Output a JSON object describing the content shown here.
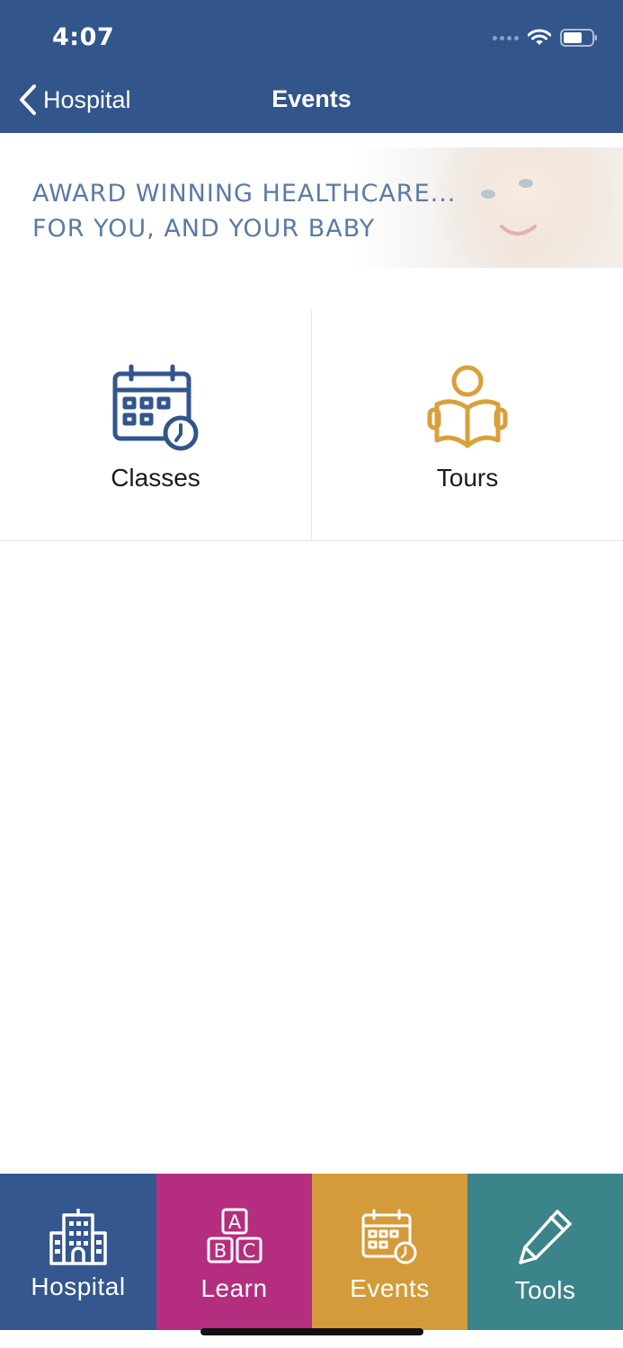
{
  "status_bar": {
    "time": "4:07",
    "icons": [
      "cellular-signal-icon",
      "wifi-icon",
      "battery-icon"
    ]
  },
  "nav": {
    "back_label": "Hospital",
    "title": "Events",
    "background": "#32558c"
  },
  "banner": {
    "line1": "AWARD WINNING HEALTHCARE...",
    "line2": "FOR YOU, AND YOUR BABY",
    "text_color": "#5a7aa6"
  },
  "tiles": [
    {
      "label": "Classes",
      "icon": "calendar-clock-icon",
      "color": "#32558c"
    },
    {
      "label": "Tours",
      "icon": "person-reading-book-icon",
      "color": "#d9a03a"
    }
  ],
  "tabs": [
    {
      "label": "Hospital",
      "icon": "hospital-building-icon",
      "color": "#33578e"
    },
    {
      "label": "Learn",
      "icon": "abc-blocks-icon",
      "color": "#b52d7e"
    },
    {
      "label": "Events",
      "icon": "calendar-clock-icon",
      "color": "#d49b3a",
      "selected": true
    },
    {
      "label": "Tools",
      "icon": "pencil-icon",
      "color": "#3a848a"
    }
  ]
}
